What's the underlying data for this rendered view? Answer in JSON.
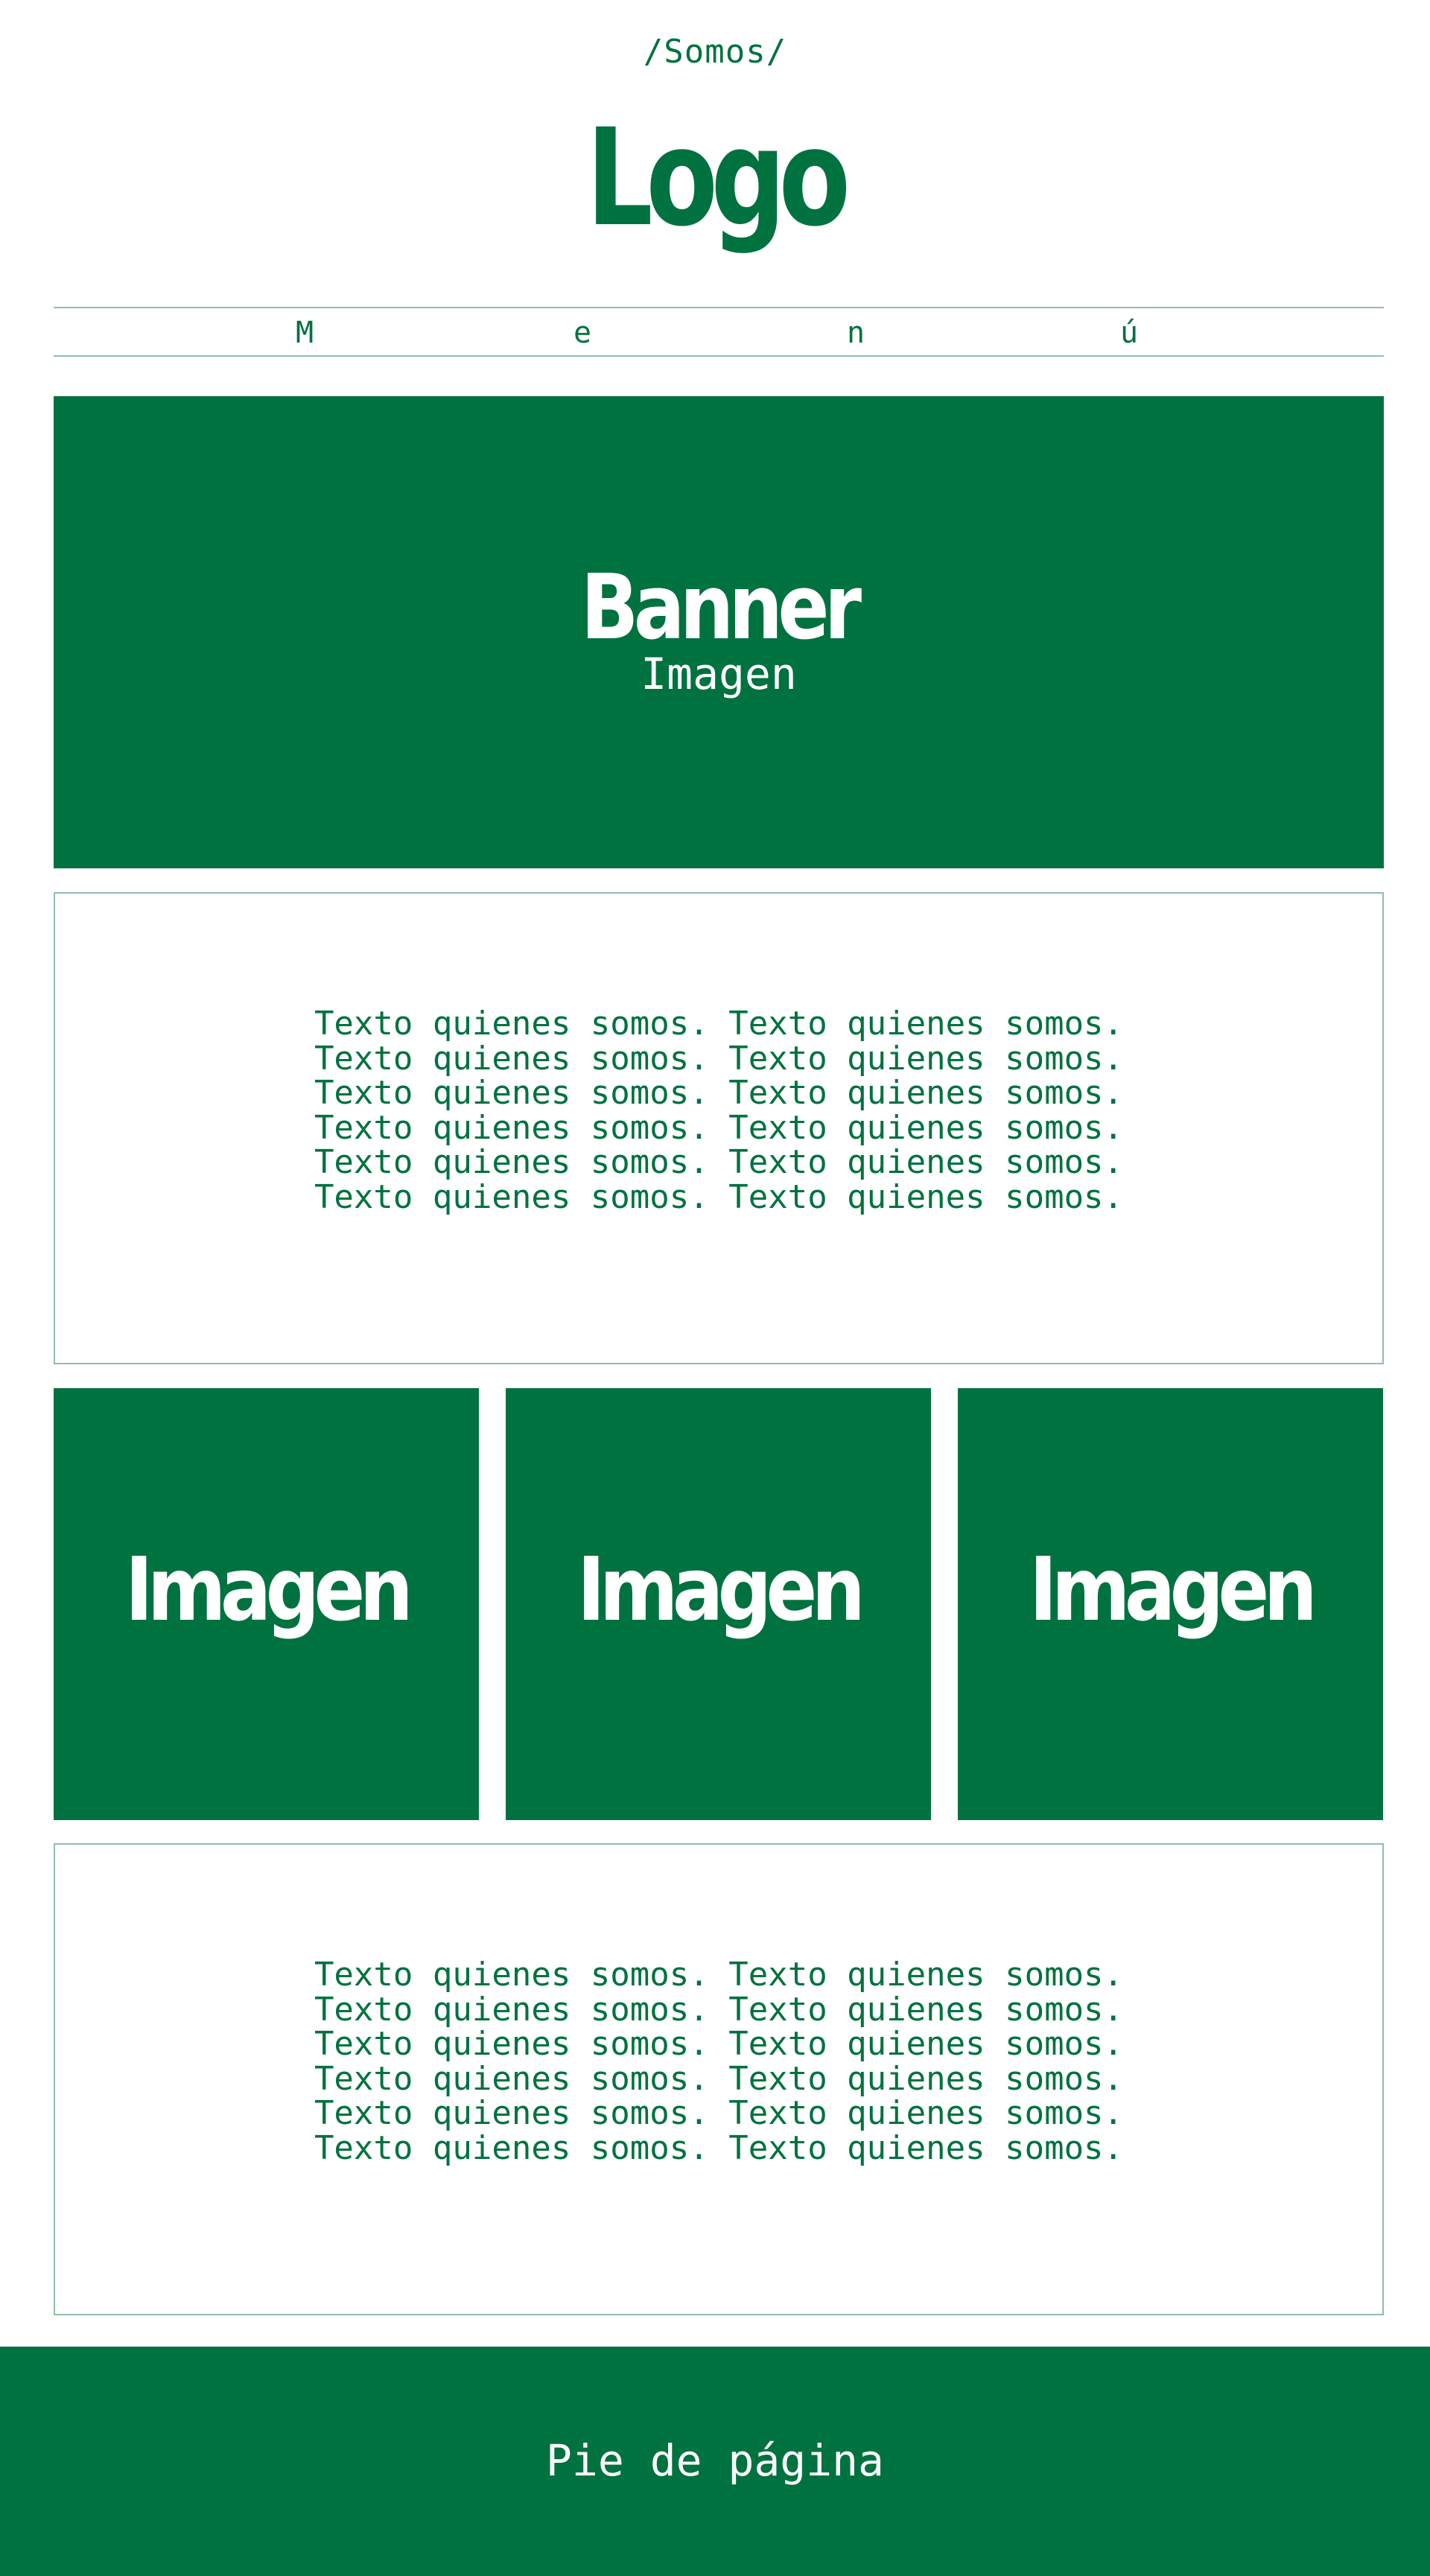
{
  "header": {
    "breadcrumb": "/Somos/",
    "logo": "Logo"
  },
  "menu": {
    "items": [
      "M",
      "e",
      "n",
      "ú"
    ]
  },
  "banner": {
    "title": "Banner",
    "subtitle": "Imagen"
  },
  "about_top": {
    "lines": [
      "Texto quienes somos. Texto quienes somos.",
      "Texto quienes somos. Texto quienes somos.",
      "Texto quienes somos. Texto quienes somos.",
      "Texto quienes somos. Texto quienes somos.",
      "Texto quienes somos. Texto quienes somos.",
      "Texto quienes somos. Texto quienes somos."
    ]
  },
  "gallery": {
    "tiles": [
      "Imagen",
      "Imagen",
      "Imagen"
    ]
  },
  "about_bottom": {
    "lines": [
      "Texto quienes somos. Texto quienes somos.",
      "Texto quienes somos. Texto quienes somos.",
      "Texto quienes somos. Texto quienes somos.",
      "Texto quienes somos. Texto quienes somos.",
      "Texto quienes somos. Texto quienes somos.",
      "Texto quienes somos. Texto quienes somos."
    ]
  },
  "footer": {
    "text": "Pie de página"
  },
  "colors": {
    "brand_green": "#00723F",
    "border_green": "#8fbfa6",
    "background": "#ffffff"
  }
}
